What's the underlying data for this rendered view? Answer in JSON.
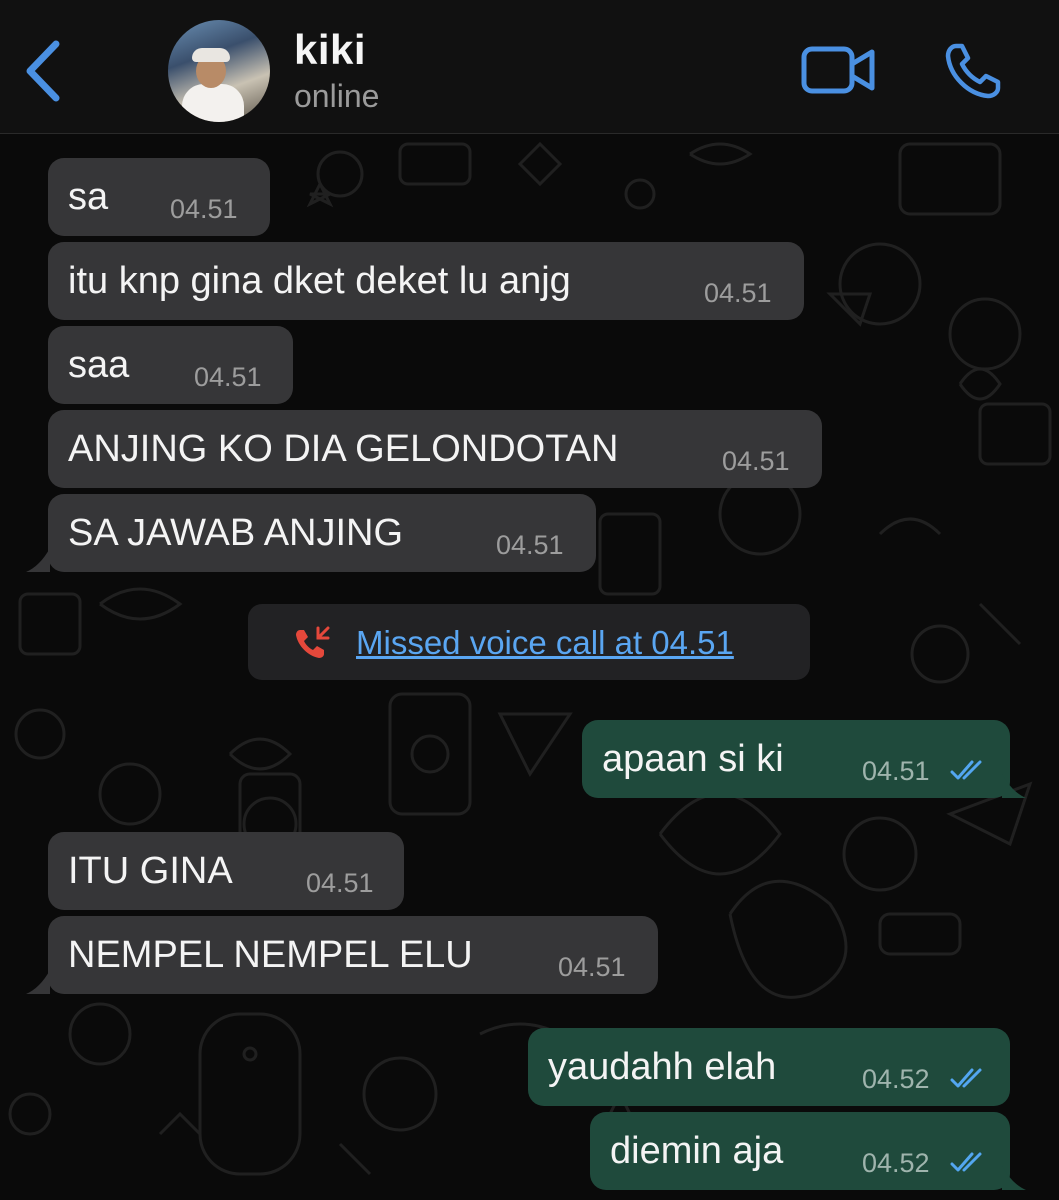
{
  "header": {
    "back_icon": "chevron-left-icon",
    "contact_name": "kiki",
    "contact_status": "online",
    "video_icon": "video-camera-icon",
    "call_icon": "phone-icon",
    "accent_color": "#4a90e2"
  },
  "messages": [
    {
      "direction": "incoming",
      "text": "sa",
      "time": "04.51"
    },
    {
      "direction": "incoming",
      "text": "itu knp gina dket deket lu anjg",
      "time": "04.51"
    },
    {
      "direction": "incoming",
      "text": "saa",
      "time": "04.51"
    },
    {
      "direction": "incoming",
      "text": "ANJING KO DIA GELONDOTAN",
      "time": "04.51"
    },
    {
      "direction": "incoming",
      "text": "SA JAWAB ANJING",
      "time": "04.51"
    },
    {
      "direction": "outgoing",
      "text": "apaan si ki",
      "time": "04.51",
      "status": "read"
    },
    {
      "direction": "incoming",
      "text": "ITU GINA",
      "time": "04.51"
    },
    {
      "direction": "incoming",
      "text": "NEMPEL NEMPEL ELU",
      "time": "04.51"
    },
    {
      "direction": "outgoing",
      "text": "yaudahh elah",
      "time": "04.52",
      "status": "read"
    },
    {
      "direction": "outgoing",
      "text": "diemin aja",
      "time": "04.52",
      "status": "read"
    }
  ],
  "system_event": {
    "icon": "missed-call-icon",
    "text": "Missed voice call at 04.51"
  },
  "colors": {
    "incoming_bubble": "#363638",
    "outgoing_bubble": "#1f4a3c",
    "missed_call_icon": "#e5483b",
    "link": "#5aa6f2",
    "read_ticks": "#53a6f0"
  }
}
